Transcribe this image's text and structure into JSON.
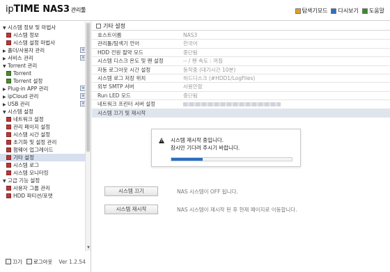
{
  "header": {
    "logo_ip": "ip",
    "logo_time": "TIME",
    "logo_model": " NAS3",
    "logo_suffix": "관리툴",
    "links": [
      {
        "label": "탐색기모드",
        "color": "#e0a020"
      },
      {
        "label": "다시보기",
        "color": "#2f6fc0"
      },
      {
        "label": "도움말",
        "color": "#3a8a2a"
      }
    ]
  },
  "sidebar": {
    "items": [
      {
        "label": "시스템 정보 및 마법사",
        "type": "group",
        "expanded": true
      },
      {
        "label": "시스템 정보",
        "type": "page"
      },
      {
        "label": "시스템 설정 마법사",
        "type": "page"
      },
      {
        "label": "폴더/사용자 관리",
        "type": "group",
        "expanded": false,
        "has_button": true
      },
      {
        "label": "서비스 관리",
        "type": "group",
        "expanded": false,
        "has_button": true
      },
      {
        "label": "Torrent 관리",
        "type": "group",
        "expanded": true
      },
      {
        "label": "Torrent",
        "type": "page",
        "green": true
      },
      {
        "label": "Torrent 설정",
        "type": "page",
        "green": true
      },
      {
        "label": "Plug-in APP 관리",
        "type": "group",
        "expanded": false,
        "has_button": true
      },
      {
        "label": "ipCloud 관리",
        "type": "group",
        "expanded": false,
        "has_button": true
      },
      {
        "label": "USB 관리",
        "type": "group",
        "expanded": false,
        "has_button": true
      },
      {
        "label": "시스템 설정",
        "type": "group",
        "expanded": true
      },
      {
        "label": "네트워크 설정",
        "type": "page"
      },
      {
        "label": "관리 페이지 설정",
        "type": "page"
      },
      {
        "label": "시스템 시간 설정",
        "type": "page"
      },
      {
        "label": "초기화 및 설정 관리",
        "type": "page"
      },
      {
        "label": "펌웨어 업그레이드",
        "type": "page"
      },
      {
        "label": "기타 설정",
        "type": "page",
        "selected": true
      },
      {
        "label": "시스템 로그",
        "type": "page"
      },
      {
        "label": "시스템 모니터링",
        "type": "page"
      },
      {
        "label": "고급 기능 설정",
        "type": "group",
        "expanded": true
      },
      {
        "label": "사용자 그룹 관리",
        "type": "page"
      },
      {
        "label": "HDD 파티션/포맷",
        "type": "page"
      }
    ],
    "footer": {
      "off_label": "끄기",
      "logout_label": "로그아웃",
      "version": "Ver 1.2.54"
    }
  },
  "main": {
    "section_title": "기타 설정",
    "settings": [
      {
        "key": "호스트이름",
        "value": "NAS3"
      },
      {
        "key": "관리툴/탐색기 언어",
        "value": "한국어"
      },
      {
        "key": "HDD 전원 절약 모드",
        "value": "중단됨"
      },
      {
        "key": "시스템 디스크 온도 및 팬 설정",
        "value": "-- / 팬 속도 : 꺼짐"
      },
      {
        "key": "자동 로그아웃 시간 설정",
        "value": "동작중 (대기시간 10분)"
      },
      {
        "key": "시스템 로그 저장 위치",
        "value": "하드디스크 (#HDD1/LogFiles)"
      },
      {
        "key": "외부 SMTP 서버",
        "value": "사용안함"
      },
      {
        "key": "Run LED 모드",
        "value": "중단됨"
      },
      {
        "key": "네트워크 프린터 서버 설정",
        "value": ""
      },
      {
        "key": "시스템 끄기 및 재시작",
        "value": "",
        "highlight": true
      }
    ],
    "actions": [
      {
        "button": "시스템 끄기",
        "desc": "NAS 시스템이 OFF 됩니다."
      },
      {
        "button": "시스템 재시작",
        "desc": "NAS 시스템이 재시작 된 후 현재 페이지로 이동합니다."
      }
    ]
  },
  "dialog": {
    "line1": "시스템 재시작 중입니다.",
    "line2": "잠시만 기다려 주시기 바랍니다.",
    "progress": 0.26
  },
  "colors": {
    "accent": "#2b6fc1",
    "selected_row": "#d7e0ee",
    "page_icon": "#b53a3a"
  }
}
